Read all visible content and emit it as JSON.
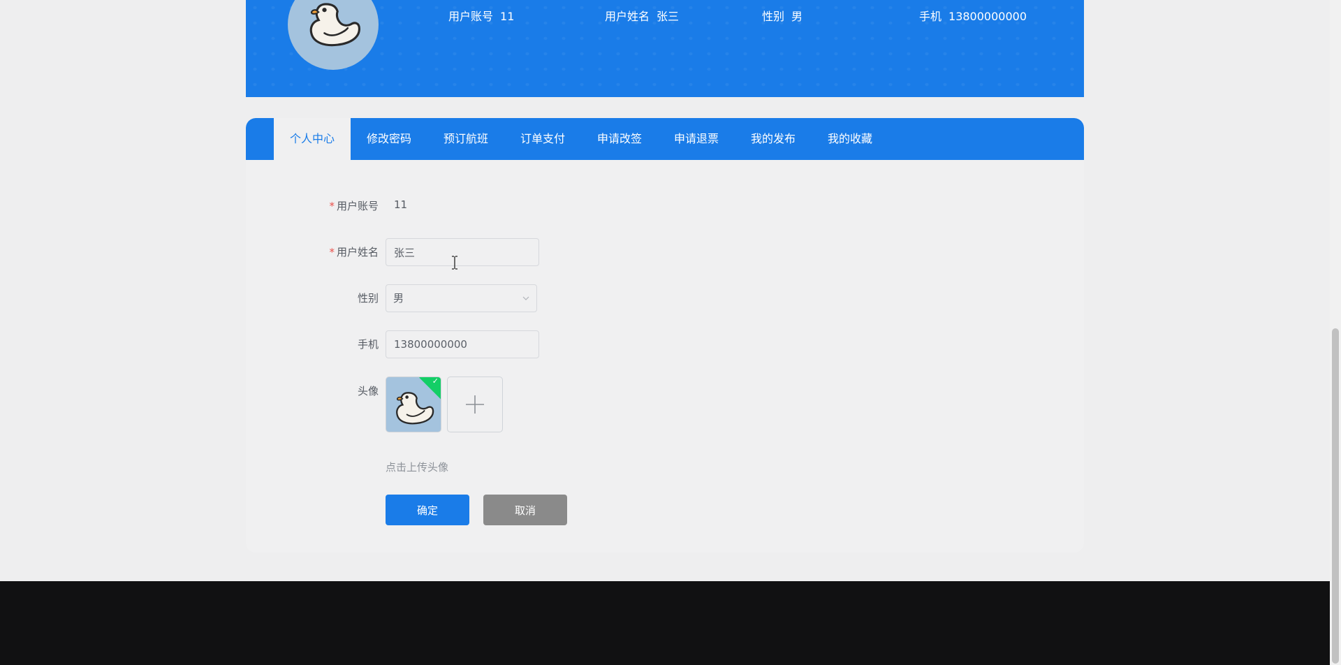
{
  "banner": {
    "account_label": "用户账号",
    "account_value": "11",
    "name_label": "用户姓名",
    "name_value": "张三",
    "gender_label": "性别",
    "gender_value": "男",
    "phone_label": "手机",
    "phone_value": "13800000000",
    "bg_color": "#1a7ce8"
  },
  "tabs": [
    {
      "label": "个人中心",
      "active": true
    },
    {
      "label": "修改密码",
      "active": false
    },
    {
      "label": "预订航班",
      "active": false
    },
    {
      "label": "订单支付",
      "active": false
    },
    {
      "label": "申请改签",
      "active": false
    },
    {
      "label": "申请退票",
      "active": false
    },
    {
      "label": "我的发布",
      "active": false
    },
    {
      "label": "我的收藏",
      "active": false
    }
  ],
  "form": {
    "required_mark": "*",
    "account_label": "用户账号",
    "account_value": "11",
    "name_label": "用户姓名",
    "name_value": "张三",
    "gender_label": "性别",
    "gender_value": "男",
    "phone_label": "手机",
    "phone_value": "13800000000",
    "avatar_label": "头像",
    "upload_hint": "点击上传头像",
    "confirm_label": "确定",
    "cancel_label": "取消"
  },
  "icons": {
    "avatar": "duck-icon",
    "upload_status": "check-icon",
    "upload_add": "plus-icon",
    "select": "chevron-down-icon",
    "cursor": "text-cursor-icon"
  },
  "colors": {
    "primary": "#1a7ce8",
    "success": "#13ce66",
    "required": "#e9504b",
    "cancel": "#8a8a8a"
  }
}
